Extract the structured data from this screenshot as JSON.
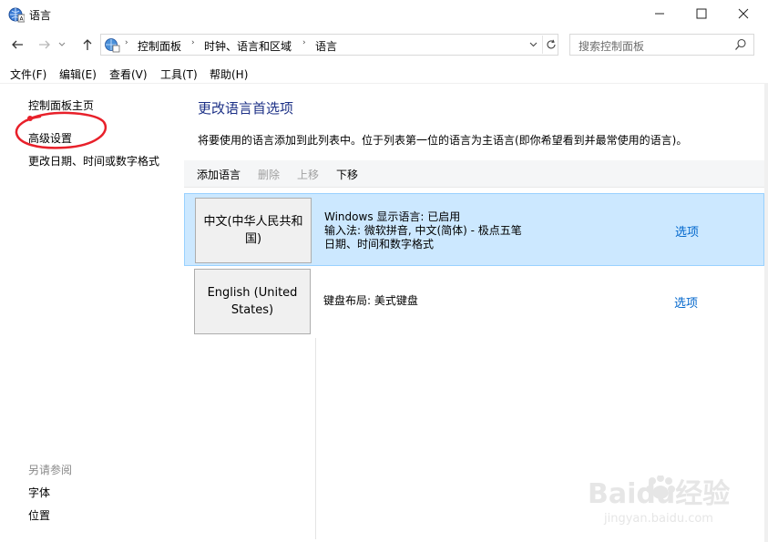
{
  "window": {
    "title": "语言",
    "buttons": {
      "minimize": "minimize-icon",
      "maximize": "maximize-icon",
      "close": "close-icon"
    }
  },
  "address": {
    "crumbs": [
      "控制面板",
      "时钟、语言和区域",
      "语言"
    ],
    "search_placeholder": "搜索控制面板"
  },
  "menu": {
    "items": [
      "文件(F)",
      "编辑(E)",
      "查看(V)",
      "工具(T)",
      "帮助(H)"
    ]
  },
  "left": {
    "links": [
      "控制面板主页",
      "高级设置",
      "更改日期、时间或数字格式"
    ],
    "see_also_heading": "另请参阅",
    "see_also": [
      "字体",
      "位置"
    ]
  },
  "main": {
    "title": "更改语言首选项",
    "description": "将要使用的语言添加到此列表中。位于列表第一位的语言为主语言(即你希望看到并最常使用的语言)。",
    "toolbar": {
      "add": "添加语言",
      "remove": "删除",
      "move_up": "上移",
      "move_down": "下移"
    },
    "languages": [
      {
        "name": "中文(中华人民共和国)",
        "details": [
          "Windows 显示语言: 已启用",
          "输入法: 微软拼音, 中文(简体) - 极点五笔",
          "日期、时间和数字格式"
        ],
        "options": "选项",
        "selected": true
      },
      {
        "name": "English (United States)",
        "details": [
          "键盘布局: 美式键盘"
        ],
        "options": "选项",
        "selected": false
      }
    ]
  },
  "watermark": {
    "brand": "Baidu经验",
    "url": "jingyan.baidu.com"
  },
  "colors": {
    "title_blue": "#1e3287",
    "link_blue": "#0066cc",
    "selection_bg": "#cce8ff",
    "selection_border": "#99d1ff",
    "annotation_red": "#e8202a"
  }
}
